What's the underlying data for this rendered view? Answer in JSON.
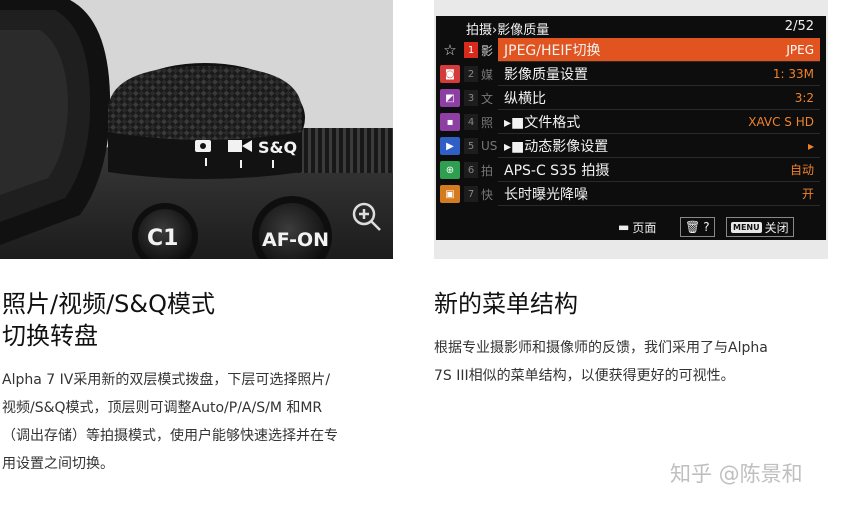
{
  "left_photo": {
    "dial_labels": [
      "S&Q"
    ],
    "button_c1": "C1",
    "button_afon": "AF-ON"
  },
  "menu_screen": {
    "breadcrumb": "拍摄›影像质量",
    "page_indicator": "2/52",
    "tabs": [
      {
        "icon": "star-icon",
        "color": "#0d0d0d"
      },
      {
        "icon": "camera-icon",
        "color": "#d43b3b"
      },
      {
        "icon": "exposure-icon",
        "color": "#8e3fa3"
      },
      {
        "icon": "af-icon",
        "color": "#8e3fa3"
      },
      {
        "icon": "playback-icon",
        "color": "#2f5fc4"
      },
      {
        "icon": "network-icon",
        "color": "#2e9e4f"
      },
      {
        "icon": "toolbox-icon",
        "color": "#d47b1f"
      }
    ],
    "sub_tabs": [
      {
        "num": "1",
        "char": "影",
        "selected": true
      },
      {
        "num": "2",
        "char": "媒",
        "selected": false
      },
      {
        "num": "3",
        "char": "文",
        "selected": false
      },
      {
        "num": "4",
        "char": "照",
        "selected": false
      },
      {
        "num": "5",
        "char": "US",
        "selected": false
      },
      {
        "num": "6",
        "char": "拍",
        "selected": false
      },
      {
        "num": "7",
        "char": "快",
        "selected": false
      }
    ],
    "items": [
      {
        "label": "JPEG/HEIF切换",
        "value": "JPEG",
        "selected": true
      },
      {
        "label": "影像质量设置",
        "value": "1: 33M",
        "selected": false
      },
      {
        "label": "纵横比",
        "value": "3:2",
        "selected": false
      },
      {
        "label": "▸■文件格式",
        "value": "XAVC S HD",
        "selected": false
      },
      {
        "label": "▸■动态影像设置",
        "value": "▸",
        "selected": false
      },
      {
        "label": "APS-C S35 拍摄",
        "value": "自动",
        "selected": false
      },
      {
        "label": "长时曝光降噪",
        "value": "开",
        "selected": false
      }
    ],
    "footer": {
      "page_label": "页面",
      "delete_label": "?",
      "close_key": "MENU",
      "close_label": "关闭"
    },
    "colors": {
      "highlight": "#e1541f",
      "value": "#f0822a"
    }
  },
  "left_section": {
    "title_line1": "照片/视频/S&Q模式",
    "title_line2": "切换转盘",
    "body_lines": [
      "Alpha 7 IV采用新的双层模式拨盘，下层可选择照片/",
      "视频/S&Q模式，顶层则可调整Auto/P/A/S/M 和MR",
      "（调出存储）等拍摄模式，使用户能够快速选择并在专",
      "用设置之间切换。"
    ]
  },
  "right_section": {
    "title": "新的菜单结构",
    "body_lines": [
      "根据专业摄影师和摄像师的反馈，我们采用了与Alpha",
      "7S III相似的菜单结构，以便获得更好的可视性。"
    ]
  },
  "watermark": "知乎 @陈景和"
}
